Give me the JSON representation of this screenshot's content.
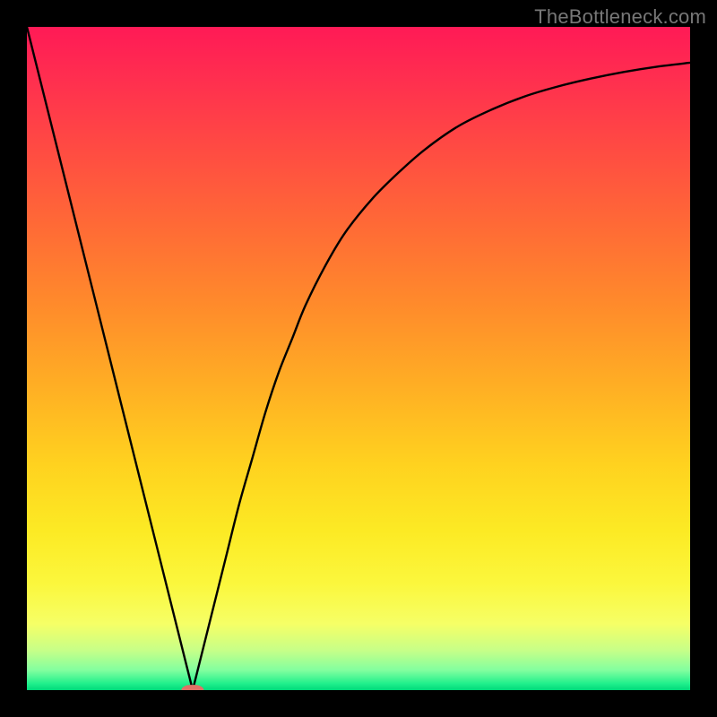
{
  "watermark": "TheBottleneck.com",
  "colors": {
    "frame": "#000000",
    "curve": "#000000",
    "marker": "#e07066"
  },
  "chart_data": {
    "type": "line",
    "title": "",
    "xlabel": "",
    "ylabel": "",
    "xlim": [
      0,
      100
    ],
    "ylim": [
      0,
      100
    ],
    "grid": false,
    "legend": false,
    "series": [
      {
        "name": "bottleneck-curve",
        "x": [
          0,
          2,
          4,
          6,
          8,
          10,
          12,
          14,
          16,
          18,
          20,
          22,
          24,
          25,
          26,
          28,
          30,
          32,
          34,
          36,
          38,
          40,
          42,
          45,
          48,
          52,
          56,
          60,
          65,
          70,
          75,
          80,
          85,
          90,
          95,
          100
        ],
        "y": [
          100,
          92,
          84,
          76,
          68,
          60,
          52,
          44,
          36,
          28,
          20,
          12,
          4,
          0,
          4,
          12,
          20,
          28,
          35,
          42,
          48,
          53,
          58,
          64,
          69,
          74,
          78,
          81.5,
          85,
          87.5,
          89.5,
          91,
          92.2,
          93.2,
          94,
          94.6
        ]
      }
    ],
    "marker": {
      "x": 25,
      "y": 0,
      "width_pct": 3.4,
      "height_pct": 1.6
    }
  }
}
